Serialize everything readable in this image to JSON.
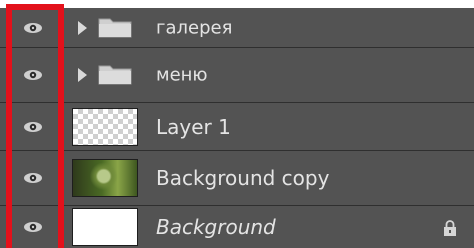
{
  "layers": [
    {
      "name": "галерея",
      "type": "folder",
      "visible": true
    },
    {
      "name": "меню",
      "type": "folder",
      "visible": true
    },
    {
      "name": "Layer 1",
      "type": "layer",
      "thumbnail": "transparent-checker",
      "visible": true
    },
    {
      "name": "Background copy",
      "type": "layer",
      "thumbnail": "photo-green",
      "visible": true
    },
    {
      "name": "Background",
      "type": "background",
      "thumbnail": "white",
      "visible": true,
      "locked": true
    }
  ],
  "colors": {
    "panel": "#535353",
    "highlight": "#e3111b",
    "text": "#e4e4e4"
  },
  "icons": {
    "visibility": "eye-icon",
    "expand": "triangle-right-icon",
    "group": "folder-icon",
    "lock": "lock-icon"
  }
}
